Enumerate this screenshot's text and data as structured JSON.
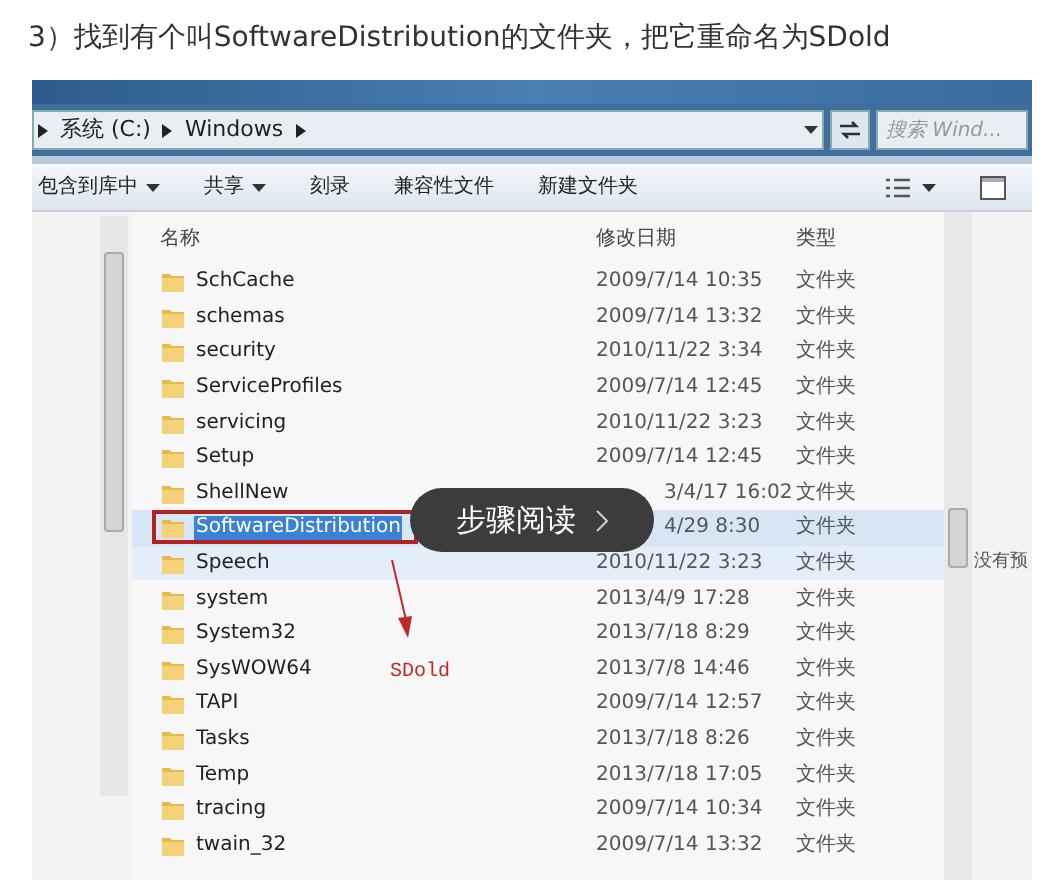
{
  "heading": "3）找到有个叫SoftwareDistribution的文件夹，把它重命名为SDold",
  "address": {
    "crumbs": [
      "系统 (C:)",
      "Windows"
    ],
    "search_placeholder": "搜索 Wind..."
  },
  "toolbar": [
    "包含到库中",
    "共享",
    "刻录",
    "兼容性文件",
    "新建文件夹"
  ],
  "toolbar_menus": [
    true,
    true,
    false,
    false,
    false
  ],
  "columns": [
    "名称",
    "修改日期",
    "类型"
  ],
  "rows": [
    {
      "name": "SchCache",
      "date": "2009/7/14 10:35",
      "type": "文件夹",
      "selected": false,
      "covered": false,
      "renaming": false
    },
    {
      "name": "schemas",
      "date": "2009/7/14 13:32",
      "type": "文件夹",
      "selected": false,
      "covered": false,
      "renaming": false
    },
    {
      "name": "security",
      "date": "2010/11/22 3:34",
      "type": "文件夹",
      "selected": false,
      "covered": false,
      "renaming": false
    },
    {
      "name": "ServiceProfiles",
      "date": "2009/7/14 12:45",
      "type": "文件夹",
      "selected": false,
      "covered": false,
      "renaming": false
    },
    {
      "name": "servicing",
      "date": "2010/11/22 3:23",
      "type": "文件夹",
      "selected": false,
      "covered": false,
      "renaming": false
    },
    {
      "name": "Setup",
      "date": "2009/7/14 12:45",
      "type": "文件夹",
      "selected": false,
      "covered": false,
      "renaming": false
    },
    {
      "name": "ShellNew",
      "date": "3/4/17 16:02",
      "type": "文件夹",
      "selected": false,
      "covered": true,
      "renaming": false
    },
    {
      "name": "SoftwareDistribution",
      "date": "4/29 8:30",
      "type": "文件夹",
      "selected": true,
      "covered": true,
      "renaming": true
    },
    {
      "name": "Speech",
      "date": "2010/11/22 3:23",
      "type": "文件夹",
      "selected": true,
      "covered": false,
      "renaming": false
    },
    {
      "name": "system",
      "date": "2013/4/9 17:28",
      "type": "文件夹",
      "selected": false,
      "covered": false,
      "renaming": false
    },
    {
      "name": "System32",
      "date": "2013/7/18 8:29",
      "type": "文件夹",
      "selected": false,
      "covered": false,
      "renaming": false
    },
    {
      "name": "SysWOW64",
      "date": "2013/7/8 14:46",
      "type": "文件夹",
      "selected": false,
      "covered": false,
      "renaming": false
    },
    {
      "name": "TAPI",
      "date": "2009/7/14 12:57",
      "type": "文件夹",
      "selected": false,
      "covered": false,
      "renaming": false
    },
    {
      "name": "Tasks",
      "date": "2013/7/18 8:26",
      "type": "文件夹",
      "selected": false,
      "covered": false,
      "renaming": false
    },
    {
      "name": "Temp",
      "date": "2013/7/18 17:05",
      "type": "文件夹",
      "selected": false,
      "covered": false,
      "renaming": false
    },
    {
      "name": "tracing",
      "date": "2009/7/14 10:34",
      "type": "文件夹",
      "selected": false,
      "covered": false,
      "renaming": false
    },
    {
      "name": "twain_32",
      "date": "2009/7/14 13:32",
      "type": "文件夹",
      "selected": false,
      "covered": false,
      "renaming": false
    }
  ],
  "preview_text": "没有预",
  "annotation": "SDold",
  "overlay_button": "步骤阅读"
}
